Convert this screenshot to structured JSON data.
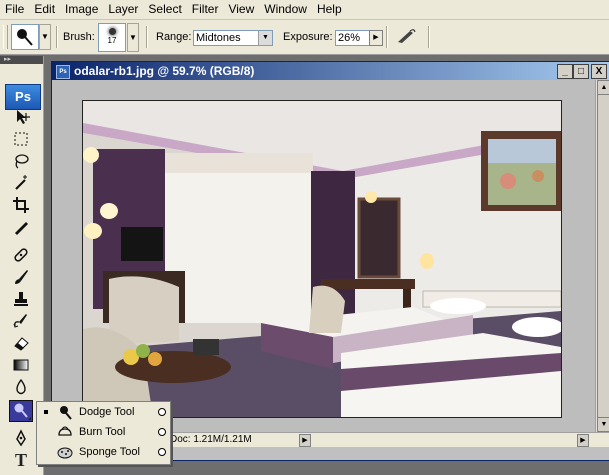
{
  "menu": [
    "File",
    "Edit",
    "Image",
    "Layer",
    "Select",
    "Filter",
    "View",
    "Window",
    "Help"
  ],
  "options": {
    "brush_label": "Brush:",
    "brush_size": "17",
    "range_label": "Range:",
    "range_value": "Midtones",
    "exposure_label": "Exposure:",
    "exposure_value": "26%"
  },
  "toolbox": {
    "logo": "Ps",
    "tools": [
      "move-icon",
      "marquee-icon",
      "lasso-icon",
      "magic-wand-icon",
      "crop-icon",
      "slice-icon",
      "healing-brush-icon",
      "brush-icon",
      "clone-stamp-icon",
      "history-brush-icon",
      "eraser-icon",
      "gradient-icon",
      "blur-icon",
      "dodge-icon",
      "pen-icon",
      "type-icon"
    ],
    "type_glyph": "T"
  },
  "document": {
    "title": "odalar-rb1.jpg @ 59.7% (RGB/8)",
    "status": "Doc: 1.21M/1.21M",
    "controls": [
      "_",
      "□",
      "X"
    ]
  },
  "flyout": [
    {
      "label": "Dodge Tool",
      "icon": "dodge-icon",
      "active": true
    },
    {
      "label": "Burn Tool",
      "icon": "burn-icon",
      "active": false
    },
    {
      "label": "Sponge Tool",
      "icon": "sponge-icon",
      "active": false
    }
  ],
  "colors": {
    "title_bar": "#0a246a",
    "chrome": "#ece9d8",
    "workspace": "#6e6e6e",
    "active_tool": "#3a3a9c"
  }
}
